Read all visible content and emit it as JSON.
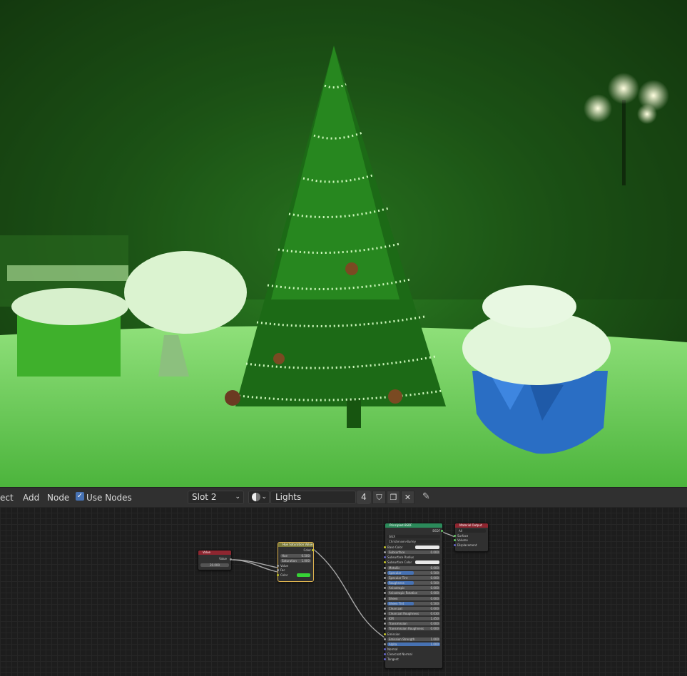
{
  "header": {
    "menu_items": [
      "ect",
      "Add",
      "Node"
    ],
    "use_nodes_label": "Use Nodes",
    "use_nodes_checked": "✓",
    "slot_label": "Slot 2",
    "material_name": "Lights",
    "user_count": "4"
  },
  "nodes": {
    "value": {
      "title": "Value",
      "output": "Value",
      "field_value": "20.000"
    },
    "hsv": {
      "title": "Hue Saturation Value",
      "output": "Color",
      "hue_label": "Hue",
      "hue_value": "0.500",
      "sat_label": "Saturation",
      "sat_value": "1.000",
      "value_label": "Value",
      "fac_label": "Fac",
      "color_label": "Color"
    },
    "bsdf": {
      "title": "Principled BSDF",
      "output": "BSDF",
      "distribution": "GGX",
      "subsurface_method": "Christensen-Burley",
      "rows": [
        {
          "label": "Base Color",
          "value": ""
        },
        {
          "label": "Subsurface",
          "value": "0.000"
        },
        {
          "label": "Subsurface Radius",
          "value": ""
        },
        {
          "label": "Subsurface Color",
          "value": ""
        },
        {
          "label": "Metallic",
          "value": "0.000"
        },
        {
          "label": "Specular",
          "value": "0.500"
        },
        {
          "label": "Specular Tint",
          "value": "0.000"
        },
        {
          "label": "Roughness",
          "value": "0.500"
        },
        {
          "label": "Anisotropic",
          "value": "0.000"
        },
        {
          "label": "Anisotropic Rotation",
          "value": "0.000"
        },
        {
          "label": "Sheen",
          "value": "0.000"
        },
        {
          "label": "Sheen Tint",
          "value": "0.500"
        },
        {
          "label": "Clearcoat",
          "value": "0.000"
        },
        {
          "label": "Clearcoat Roughness",
          "value": "0.030"
        },
        {
          "label": "IOR",
          "value": "1.450"
        },
        {
          "label": "Transmission",
          "value": "0.000"
        },
        {
          "label": "Transmission Roughness",
          "value": "0.000"
        },
        {
          "label": "Emission",
          "value": ""
        },
        {
          "label": "Emission Strength",
          "value": "1.000"
        },
        {
          "label": "Alpha",
          "value": "1.000"
        },
        {
          "label": "Normal",
          "value": ""
        },
        {
          "label": "Clearcoat Normal",
          "value": ""
        },
        {
          "label": "Tangent",
          "value": ""
        }
      ]
    },
    "output": {
      "title": "Material Output",
      "target": "All",
      "inputs": [
        "Surface",
        "Volume",
        "Displacement"
      ]
    }
  },
  "colors": {
    "header_bg": "#303030",
    "accent_blue": "#4772b3",
    "render_green": "#2f8a25"
  }
}
